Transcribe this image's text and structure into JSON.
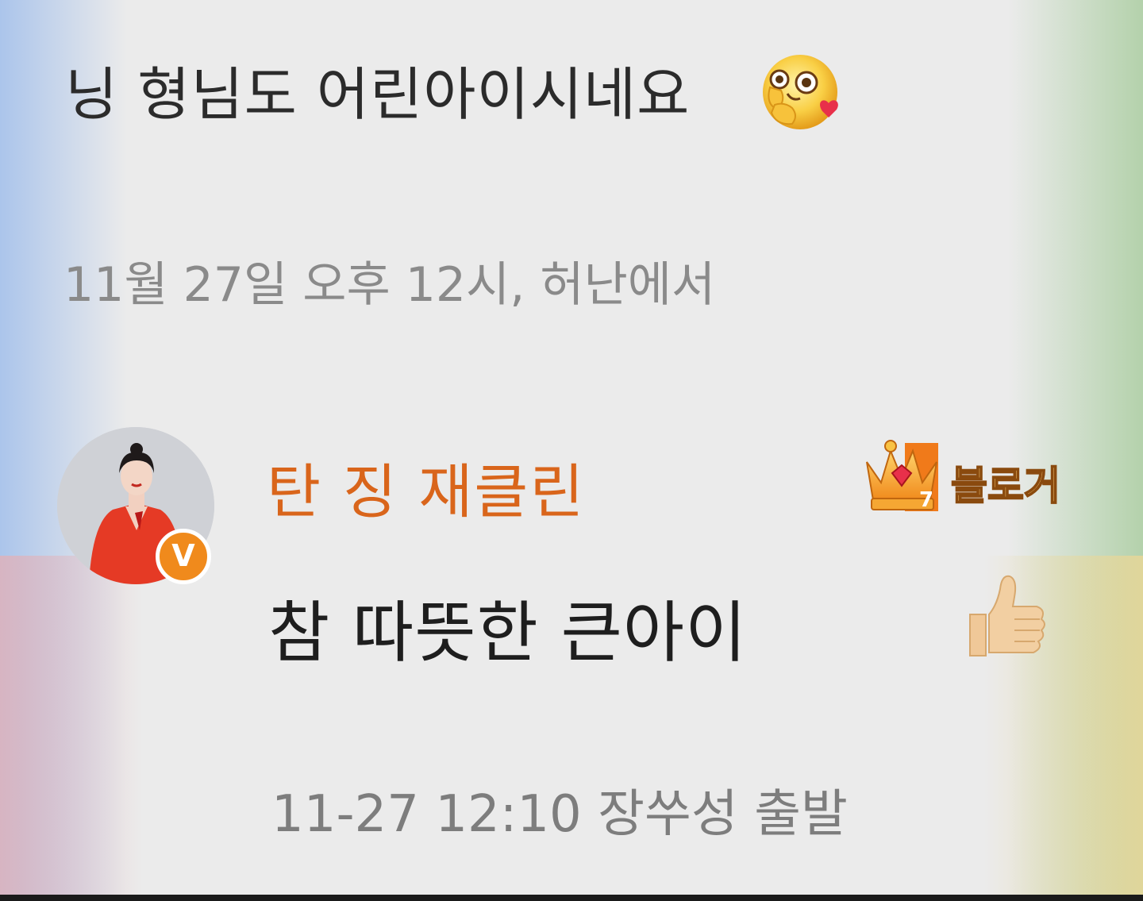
{
  "previous_comment": {
    "text": "닝 형님도 어린아이시네요",
    "emoji": "shy-blushing-emoji",
    "timestamp": "11월 27일 오후 12시, 허난에서"
  },
  "reply": {
    "username": "탄 징 재클린",
    "verified_badge_letter": "V",
    "verified_badge_color": "#f08a1c",
    "username_color": "#d9651b",
    "level_badge": {
      "icon": "crown-level-icon",
      "level": "7"
    },
    "role_label": "블로거",
    "text": "참 따뜻한 큰아이",
    "reaction_icon": "thumbs-up-icon",
    "timestamp": "11-27 12:10 장쑤성 출발"
  }
}
